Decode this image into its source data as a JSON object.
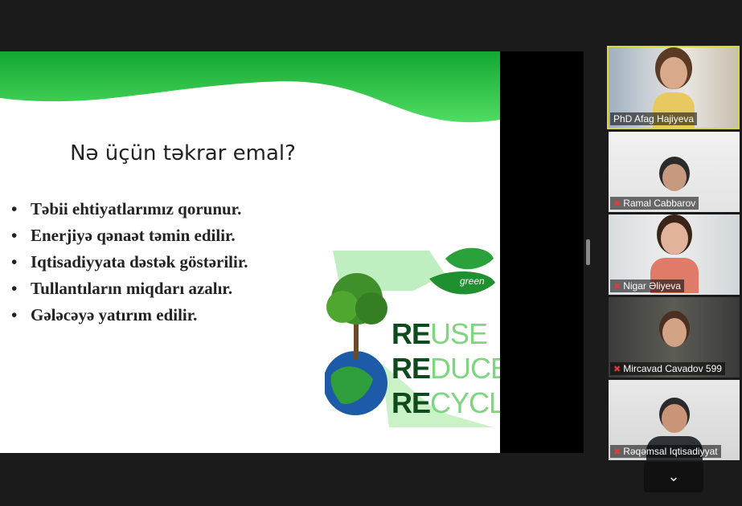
{
  "slide": {
    "title": "Nə üçün təkrar emal?",
    "bullets": [
      "Təbii ehtiyatlarımız qorunur.",
      "Enerjiyə qənaət təmin edilir.",
      "Iqtisadiyyata dəstək göstərilir.",
      "Tullantıların miqdarı azalır.",
      "Gələcəyə yatırım edilir."
    ],
    "bullet_symbol": "•",
    "graphic": {
      "lines": [
        {
          "bold": "RE",
          "rest": "USE"
        },
        {
          "bold": "RE",
          "rest": "DUCE"
        },
        {
          "bold": "RE",
          "rest": "CYCLE"
        }
      ],
      "leaf_text": "green"
    },
    "colors": {
      "accent": "#1fbf3b",
      "brand_dark": "#0f4a1c",
      "brand_light": "#7ed67e"
    }
  },
  "participants": [
    {
      "name": "PhD Afag Hajiyeva",
      "muted": false,
      "active_speaker": true
    },
    {
      "name": "Ramal Cabbarov",
      "muted": true
    },
    {
      "name": "Nigar Əliyeva",
      "muted": true
    },
    {
      "name": "Mircavad Cavadov 599",
      "muted": true
    },
    {
      "name": "Rəqəmsal Iqtisadiyyat",
      "muted": true
    }
  ],
  "controls": {
    "scroll_down_icon": "chevron-down-icon",
    "scroll_down_glyph": "⌄"
  }
}
